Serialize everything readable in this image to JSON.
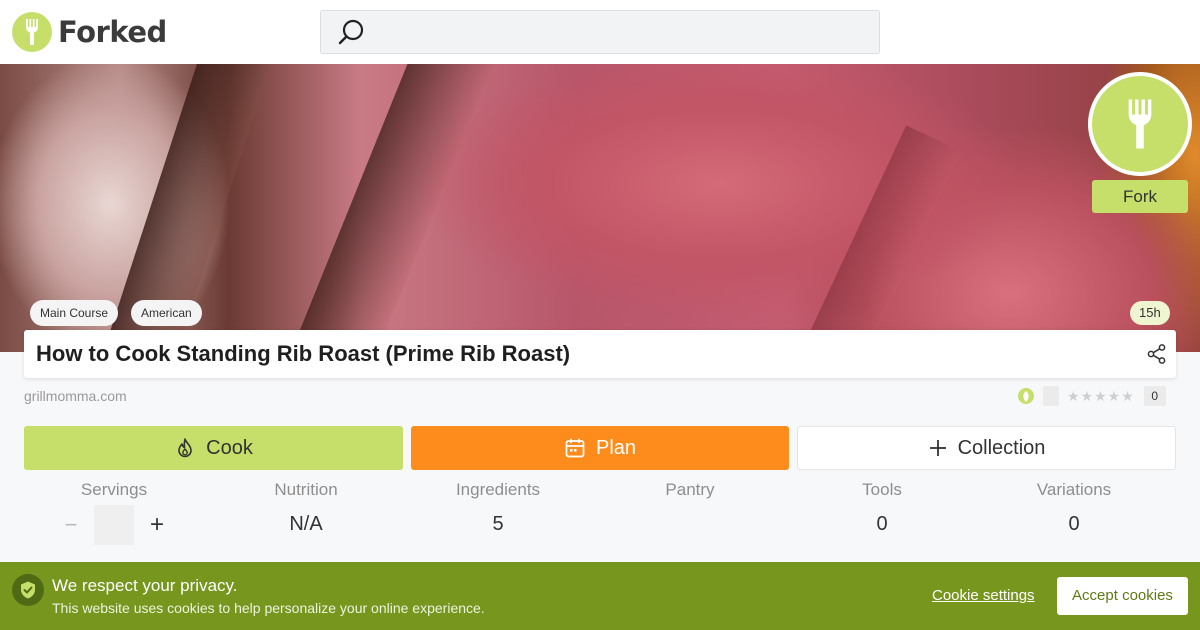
{
  "brand": {
    "name": "Forked",
    "accent": "#c6df6b"
  },
  "search": {
    "placeholder": "",
    "icon": "search-icon"
  },
  "hero": {
    "tags": [
      "Main Course",
      "American"
    ],
    "time": "15h",
    "fork_label": "Fork"
  },
  "recipe": {
    "title": "How to Cook Standing Rib Roast (Prime Rib Roast)",
    "source": "grillmomma.com",
    "rating_count": "0",
    "stars": "★★★★★"
  },
  "actions": {
    "cook": "Cook",
    "plan": "Plan",
    "collection": "Collection",
    "plan_color": "#fd8c1d"
  },
  "stats": {
    "servings_label": "Servings",
    "nutrition_label": "Nutrition",
    "nutrition_value": "N/A",
    "ingredients_label": "Ingredients",
    "ingredients_value": "5",
    "pantry_label": "Pantry",
    "pantry_value": "",
    "tools_label": "Tools",
    "tools_value": "0",
    "variations_label": "Variations",
    "variations_value": "0",
    "minus": "−",
    "plus": "+"
  },
  "cookie": {
    "title": "We respect your privacy.",
    "text": "This website uses cookies to help personalize your online experience.",
    "settings": "Cookie settings",
    "accept": "Accept cookies",
    "background": "#76961e"
  }
}
